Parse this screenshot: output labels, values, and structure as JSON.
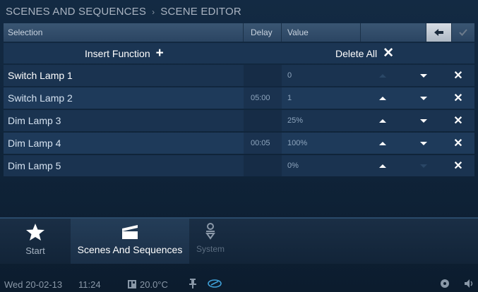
{
  "breadcrumb": {
    "parent": "SCENES AND SEQUENCES",
    "separator": "›",
    "current": "SCENE EDITOR"
  },
  "table_header": {
    "selection": "Selection",
    "delay": "Delay",
    "value": "Value",
    "back_icon": "back-arrow-icon",
    "confirm_icon": "checkmark-icon"
  },
  "actions": {
    "insert_label": "Insert Function",
    "insert_symbol": "+",
    "delete_label": "Delete All",
    "delete_symbol": "✕"
  },
  "rows": [
    {
      "name": "Switch Lamp 1",
      "delay": "",
      "value": "0",
      "up_enabled": false,
      "down_enabled": true
    },
    {
      "name": "Switch Lamp 2",
      "delay": "05:00",
      "value": "1",
      "up_enabled": true,
      "down_enabled": true
    },
    {
      "name": "Dim Lamp 3",
      "delay": "",
      "value": "25%",
      "up_enabled": true,
      "down_enabled": true
    },
    {
      "name": "Dim Lamp 4",
      "delay": "00:05",
      "value": "100%",
      "up_enabled": true,
      "down_enabled": true
    },
    {
      "name": "Dim Lamp 5",
      "delay": "",
      "value": "0%",
      "up_enabled": true,
      "down_enabled": false
    }
  ],
  "row_delete_symbol": "✕",
  "nav": {
    "tabs": [
      {
        "label": "Start",
        "icon": "star-icon"
      },
      {
        "label": "Scenes And Sequences",
        "icon": "clapperboard-icon",
        "active": true
      },
      {
        "label": "System",
        "icon": "system-icon"
      }
    ]
  },
  "status": {
    "date": "Wed 20-02-13",
    "time": "11:24",
    "temperature": "20.0°C"
  },
  "colors": {
    "background": "#132a43",
    "header": "#3a5673",
    "row": "#1a3350",
    "row_alt": "#1e3a5a",
    "text": "#ffffff",
    "muted": "#8fa6be"
  }
}
